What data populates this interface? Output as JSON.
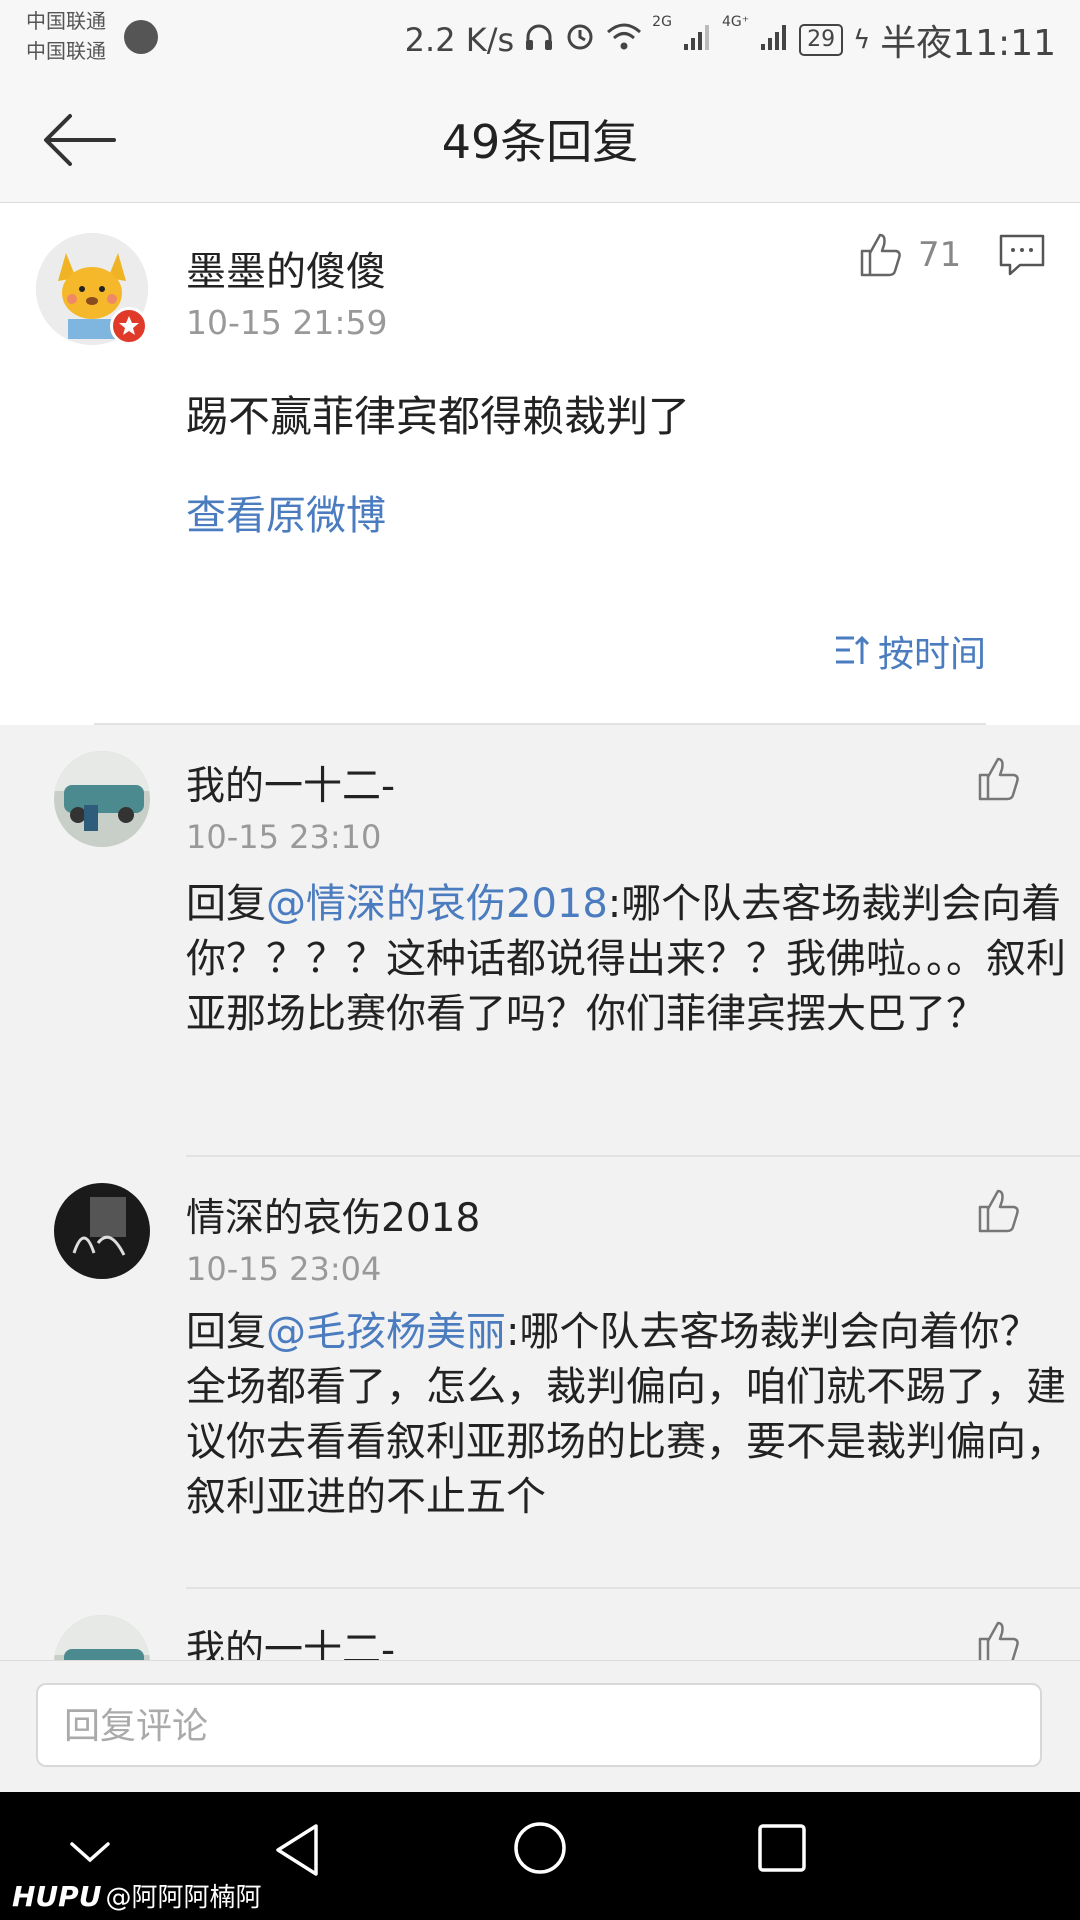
{
  "status_bar": {
    "carrier_1": "中国联通",
    "carrier_2": "中国联通",
    "speed": "2.2 K/s",
    "net_2g": "2G",
    "net_4g": "4G⁺",
    "battery": "29",
    "time": "半夜11:11"
  },
  "header": {
    "title": "49条回复",
    "back_icon": "arrow-left-icon"
  },
  "main_comment": {
    "author": "墨墨的傻傻",
    "time": "10-15 21:59",
    "likes": "71",
    "text": "踢不赢菲律宾都得赖裁判了",
    "view_original": "查看原微博",
    "sort_label": "按时间"
  },
  "replies": [
    {
      "author": "我的一十二-",
      "time": "10-15 23:10",
      "prefix": "回复",
      "mention": "@情深的哀伤2018",
      "text": ":哪个队去客场裁判会向着你？？？？这种话都说得出来？？我佛啦。。。叙利亚那场比赛你看了吗？你们菲律宾摆大巴了？"
    },
    {
      "author": "情深的哀伤2018",
      "time": "10-15 23:04",
      "prefix": "回复",
      "mention": "@毛孩杨美丽",
      "text": ":哪个队去客场裁判会向着你？全场都看了，怎么，裁判偏向，咱们就不踢了，建议你去看看叙利亚那场的比赛，要不是裁判偏向，叙利亚进的不止五个"
    },
    {
      "author": "我的一十二-"
    }
  ],
  "input": {
    "placeholder": "回复评论"
  },
  "watermark": {
    "brand": "HUPU",
    "user": "@阿阿阿楠阿"
  },
  "colors": {
    "link": "#4a7cbf",
    "nav_bg": "#000000"
  }
}
